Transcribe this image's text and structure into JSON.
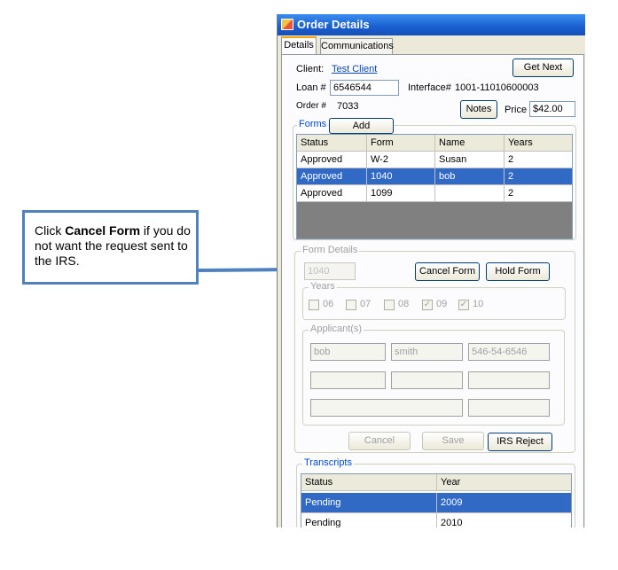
{
  "callout": {
    "prefix": "Click ",
    "bold": "Cancel Form",
    "suffix": " if you do not want the request sent to the IRS."
  },
  "window": {
    "title": "Order Details",
    "tabs": [
      "Details",
      "Communications"
    ]
  },
  "details": {
    "client_label": "Client:",
    "client_value": "Test Client",
    "get_next": "Get Next",
    "loan_label": "Loan #",
    "loan_value": "6546544",
    "interface_label": "Interface#",
    "interface_value": "1001-11010600003",
    "order_label": "Order #",
    "order_value": "7033",
    "notes": "Notes",
    "price_label": "Price",
    "price_value": "$42.00"
  },
  "forms": {
    "label": "Forms",
    "add": "Add",
    "columns": [
      "Status",
      "Form",
      "Name",
      "Years"
    ],
    "rows": [
      [
        "Approved",
        "W-2",
        "Susan",
        "2"
      ],
      [
        "Approved",
        "1040",
        "bob",
        "2"
      ],
      [
        "Approved",
        "1099",
        "",
        "2"
      ]
    ]
  },
  "form_details": {
    "label": "Form Details",
    "form_value": "1040",
    "cancel_form": "Cancel Form",
    "hold_form": "Hold Form",
    "years_label": "Years",
    "years": [
      {
        "label": "06",
        "checked": false
      },
      {
        "label": "07",
        "checked": false
      },
      {
        "label": "08",
        "checked": false
      },
      {
        "label": "09",
        "checked": true
      },
      {
        "label": "10",
        "checked": true
      }
    ],
    "applicants_label": "Applicant(s)",
    "first_name": "bob",
    "last_name": "smith",
    "ssn": "546-54-6546",
    "cancel": "Cancel",
    "save": "Save",
    "irs_reject": "IRS Reject"
  },
  "transcripts": {
    "label": "Transcripts",
    "columns": [
      "Status",
      "Year"
    ],
    "rows": [
      [
        "Pending",
        "2009"
      ],
      [
        "Pending",
        "2010"
      ]
    ]
  },
  "colors": {
    "selection": "#316ac5",
    "titlebar": "#1a5fd0",
    "callout_border": "#4f81bd"
  }
}
